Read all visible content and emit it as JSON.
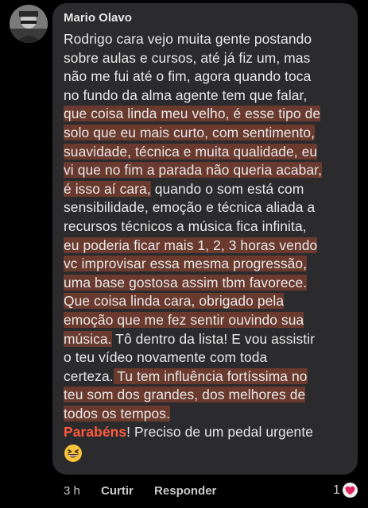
{
  "comment": {
    "author": "Mario Olavo",
    "lines": [
      {
        "segments": [
          {
            "text": "Rodrigo cara vejo muita gente postando",
            "style": "normal"
          }
        ]
      },
      {
        "segments": [
          {
            "text": "sobre aulas e cursos, até já fiz um, mas",
            "style": "normal"
          }
        ]
      },
      {
        "segments": [
          {
            "text": "não me fui até o fim, agora quando toca",
            "style": "normal"
          }
        ]
      },
      {
        "segments": [
          {
            "text": "no fundo da alma agente tem que falar,",
            "style": "normal"
          }
        ]
      },
      {
        "segments": [
          {
            "text": "que coisa linda meu velho, é esse tipo de",
            "style": "hl"
          }
        ]
      },
      {
        "segments": [
          {
            "text": "solo que eu mais curto, com sentimento,",
            "style": "hl"
          }
        ]
      },
      {
        "segments": [
          {
            "text": "suavidade, técnica e muita qualidade, eu",
            "style": "hl"
          }
        ]
      },
      {
        "segments": [
          {
            "text": "vi que no fim a parada não queria acabar,",
            "style": "hl"
          }
        ]
      },
      {
        "segments": [
          {
            "text": "é isso aí cara,",
            "style": "hl"
          },
          {
            "text": " quando o som está com",
            "style": "normal"
          }
        ]
      },
      {
        "segments": [
          {
            "text": "sensibilidade, emoção e técnica aliada a",
            "style": "normal"
          }
        ]
      },
      {
        "segments": [
          {
            "text": "recursos técnicos a música fica infinita,",
            "style": "normal"
          }
        ]
      },
      {
        "segments": [
          {
            "text": "eu poderia ficar mais 1, 2, 3 horas vendo",
            "style": "hl"
          }
        ]
      },
      {
        "segments": [
          {
            "text": "vc improvisar essa mesma progressão,",
            "style": "hl"
          }
        ]
      },
      {
        "segments": [
          {
            "text": "uma base gostosa assim tbm favorece.",
            "style": "hl"
          }
        ]
      },
      {
        "segments": [
          {
            "text": "Que coisa linda cara, obrigado pela",
            "style": "hl"
          }
        ]
      },
      {
        "segments": [
          {
            "text": "emoção que me fez sentir ouvindo sua",
            "style": "hl"
          }
        ]
      },
      {
        "segments": [
          {
            "text": "música.",
            "style": "hl"
          },
          {
            "text": " Tô dentro da lista! E vou assistir",
            "style": "normal"
          }
        ]
      },
      {
        "segments": [
          {
            "text": "o teu vídeo novamente com toda",
            "style": "normal"
          }
        ]
      },
      {
        "segments": [
          {
            "text": "certeza.",
            "style": "normal"
          },
          {
            "text": " Tu tem influência fortíssima no",
            "style": "hl"
          }
        ]
      },
      {
        "segments": [
          {
            "text": "teu som dos grandes, dos melhores de",
            "style": "hl"
          }
        ]
      },
      {
        "segments": [
          {
            "text": "todos os tempos.",
            "style": "hl"
          }
        ]
      },
      {
        "segments": [
          {
            "text": "Parabéns",
            "style": "red"
          },
          {
            "text": "! Preciso de um pedal urgente",
            "style": "normal"
          }
        ]
      }
    ],
    "emoji": "grinning-squinting-face",
    "time": "3 h",
    "like_label": "Curtir",
    "reply_label": "Responder",
    "reaction_count": "1",
    "reaction_icon": "heart-icon"
  },
  "colors": {
    "background": "#000000",
    "bubble": "#2b2b2d",
    "highlight": "#6a3a2e",
    "accent": "#ff5a3c",
    "heart": "#e0245e"
  }
}
